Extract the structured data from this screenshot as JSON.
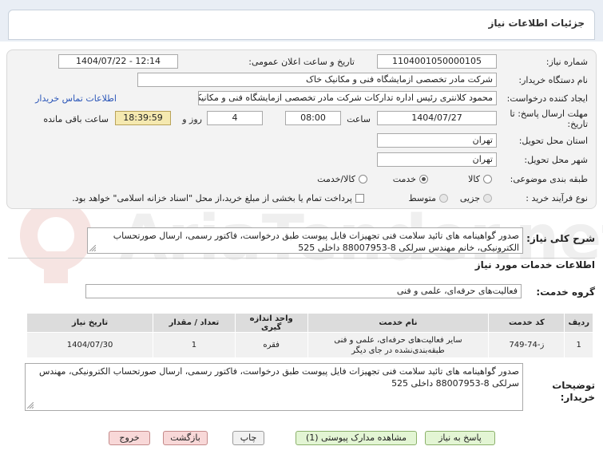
{
  "page": {
    "title": "جزئیات اطلاعات نیاز"
  },
  "form": {
    "need_number_label": "شماره نیاز:",
    "need_number": "1104001050000105",
    "announce_label": "تاریخ و ساعت اعلان عمومی:",
    "announce_value": "1404/07/22 - 12:14",
    "buyer_label": "نام دستگاه خریدار:",
    "buyer_value": "شرکت مادر تخصصی ازمایشگاه فنی و مکانیک خاک",
    "creator_label": "ایجاد کننده درخواست:",
    "creator_value": "محمود کلانتری رئیس اداره تدارکات شرکت مادر تخصصی ازمایشگاه فنی و مکانیک",
    "contact_link": "اطلاعات تماس خریدار",
    "deadline_label_1": "مهلت ارسال پاسخ: تا",
    "deadline_label_2": "تاریخ:",
    "deadline_date": "1404/07/27",
    "hour_label": "ساعت",
    "deadline_hour": "08:00",
    "days_value": "4",
    "days_label": "روز و",
    "remaining_time": "18:39:59",
    "remaining_label": "ساعت باقی مانده",
    "province_label": "استان محل تحویل:",
    "province_value": "تهران",
    "city_label": "شهر محل تحویل:",
    "city_value": "تهران",
    "category_label": "طبقه بندی موضوعی:",
    "category_options": [
      "کالا",
      "خدمت",
      "کالا/خدمت"
    ],
    "category_selected": "خدمت",
    "process_label": "نوع فرآیند خرید :",
    "process_options": [
      "جزیی",
      "متوسط"
    ],
    "treasury_note": "پرداخت تمام یا بخشی از مبلغ خرید،از محل \"اسناد خزانه اسلامی\" خواهد بود."
  },
  "description": {
    "label": "شرح کلی نیاز:",
    "text": "صدور گواهینامه های تائید سلامت فنی تجهیزات فایل پیوست طبق درخواست، فاکتور رسمی، ارسال صورتحساب الکترونیکی، خانم مهندس سرلکی 8-88007953 داخلی 525"
  },
  "services": {
    "section_title": "اطلاعات خدمات مورد نیاز",
    "group_label": "گروه خدمت:",
    "group_value": "فعالیت‌های حرفه‌ای، علمی و فنی",
    "columns": [
      "ردیف",
      "کد خدمت",
      "نام خدمت",
      "واحد اندازه گیری",
      "تعداد / مقدار",
      "تاریخ نیاز"
    ],
    "rows": [
      {
        "index": "1",
        "code": "ز-74-749",
        "name": "سایر فعالیت‌های حرفه‌ای، علمی و فنی طبقه‌بندی‌نشده در جای دیگر",
        "unit": "فقره",
        "quantity": "1",
        "date": "1404/07/30"
      }
    ]
  },
  "buyer_notes": {
    "label": "توضیحات خریدار:",
    "text": "صدور گواهینامه های تائید سلامت فنی تجهیزات فایل پیوست طبق درخواست، فاکتور رسمی، ارسال صورتحساب الکترونیکی، مهندس سرلکی 8-88007953 داخلی 525"
  },
  "buttons": {
    "reply": "پاسخ به نیاز",
    "view_docs": "مشاهده مدارک پیوستی (1)",
    "print": "چاپ",
    "back": "بازگشت",
    "exit": "خروج"
  },
  "watermark_text": "AriaTender.net",
  "colors": {
    "remaining_bg": "#f5e9b0",
    "link": "#2a55b8",
    "reply_button": "#e3f5d4",
    "exit_button": "#f8d8d8"
  }
}
